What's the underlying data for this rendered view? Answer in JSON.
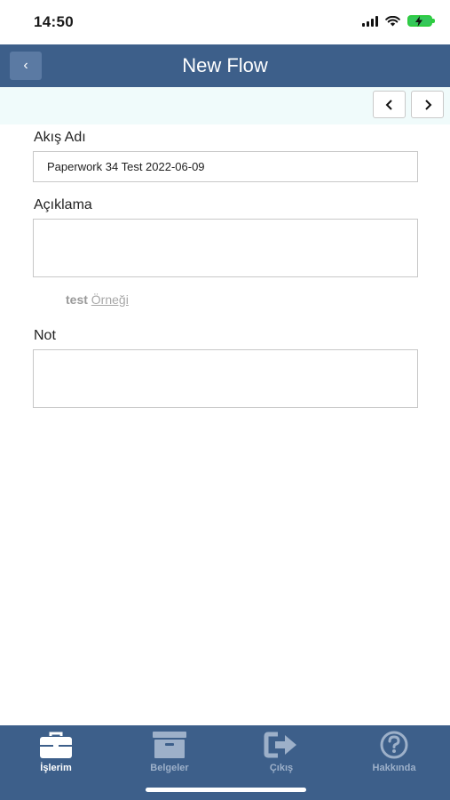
{
  "status_bar": {
    "time": "14:50"
  },
  "nav": {
    "title": "New Flow",
    "back_label": "‹"
  },
  "pager": {
    "prev_label": "‹",
    "next_label": "›"
  },
  "form": {
    "flow_name": {
      "label": "Akış Adı",
      "value": "Paperwork 34 Test 2022-06-09"
    },
    "description": {
      "label": "Açıklama",
      "value": ""
    },
    "example": {
      "prefix": "test",
      "link_text": "Örneği"
    },
    "note": {
      "label": "Not",
      "value": ""
    }
  },
  "tab_bar": {
    "tabs": [
      {
        "label": "İşlerim",
        "icon": "briefcase-icon",
        "active": true
      },
      {
        "label": "Belgeler",
        "icon": "archive-box-icon",
        "active": false
      },
      {
        "label": "Çıkış",
        "icon": "logout-arrow-icon",
        "active": false
      },
      {
        "label": "Hakkında",
        "icon": "question-circle-icon",
        "active": false
      }
    ]
  },
  "colors": {
    "nav_background": "#3d5f8a",
    "pager_background": "#f0fbfb",
    "tab_active": "#ffffff",
    "tab_inactive": "#9db0c9"
  }
}
